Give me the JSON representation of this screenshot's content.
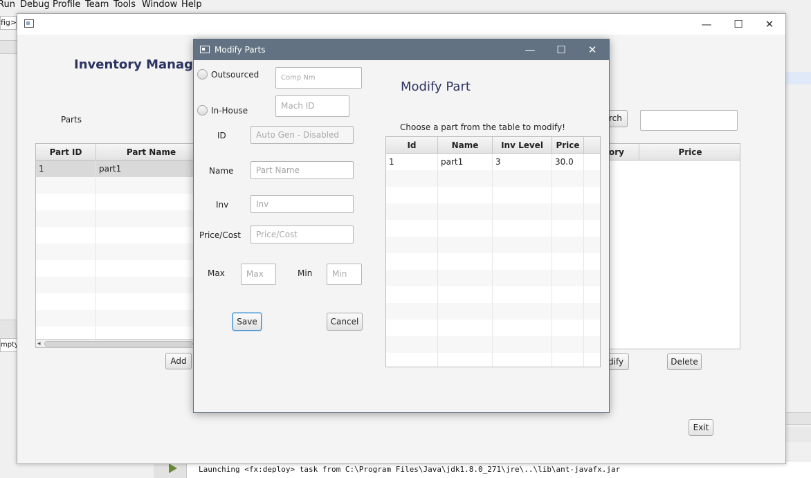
{
  "ide": {
    "menu": [
      "Run",
      "Debug",
      "Profile",
      "Team",
      "Tools",
      "Window",
      "Help"
    ],
    "breadcrumb": "fig>",
    "empty_label": "mpty",
    "console_text": "Launching <fx:deploy> task from C:\\Program Files\\Java\\jdk1.8.0_271\\jre\\..\\lib\\ant-javafx.jar"
  },
  "main_window": {
    "title": "Inventory Managem",
    "parts_label": "Parts",
    "parts_table": {
      "columns": [
        "Part ID",
        "Part Name"
      ],
      "rows": [
        [
          "1",
          "part1"
        ]
      ]
    },
    "add_button": "Add",
    "search_button": "rch",
    "search_value": "",
    "products_table": {
      "columns": [
        "ory",
        "Price"
      ]
    },
    "modify_button": "dify",
    "delete_button": "Delete",
    "exit_button": "Exit",
    "controls": {
      "minimize": "—",
      "maximize": "☐",
      "close": "✕"
    }
  },
  "dialog": {
    "title": "Modify Parts",
    "controls": {
      "minimize": "—",
      "maximize": "☐",
      "close": "✕"
    },
    "outsourced_label": "Outsourced",
    "inhouse_label": "In-House",
    "comp_placeholder": "Comp Nm",
    "mach_placeholder": "Mach ID",
    "id_label": "ID",
    "id_placeholder": "Auto Gen - Disabled",
    "name_label": "Name",
    "name_placeholder": "Part Name",
    "inv_label": "Inv",
    "inv_placeholder": "Inv",
    "price_label": "Price/Cost",
    "price_placeholder": "Price/Cost",
    "max_label": "Max",
    "max_placeholder": "Max",
    "min_label": "Min",
    "min_placeholder": "Min",
    "save_button": "Save",
    "cancel_button": "Cancel",
    "heading": "Modify Part",
    "instructions": "Choose a part from the table to modify!",
    "table": {
      "columns": [
        "Id",
        "Name",
        "Inv Level",
        "Price"
      ],
      "rows": [
        [
          "1",
          "part1",
          "3",
          "30.0"
        ]
      ]
    }
  }
}
